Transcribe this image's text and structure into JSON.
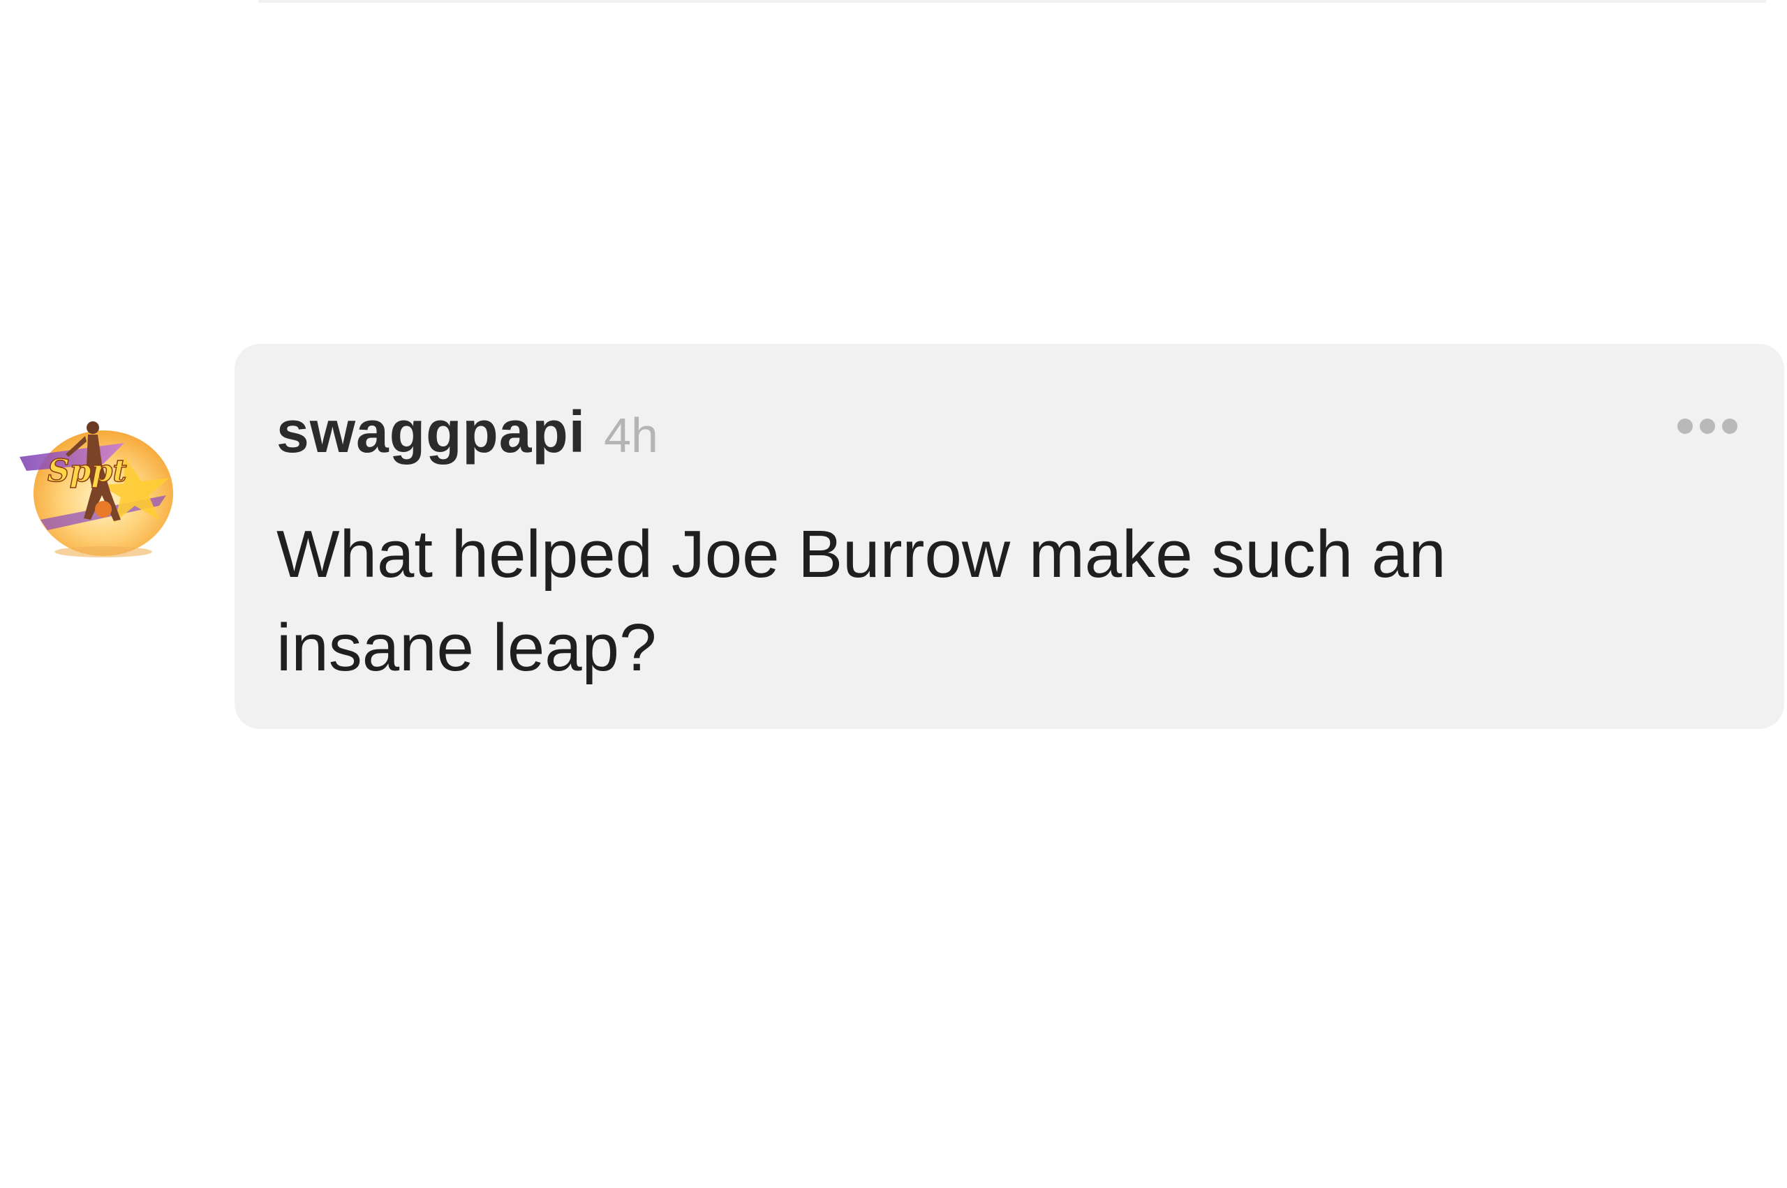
{
  "comment": {
    "username": "swaggpapi",
    "timestamp": "4h",
    "text": "What helped Joe Burrow make such an insane leap?",
    "more_icon": "ellipsis-horizontal-icon",
    "avatar_icon": "basketball-player-logo-icon"
  },
  "colors": {
    "bubble_background": "#f1f1f1",
    "username": "#2b2b2b",
    "timestamp": "#b4b4b4",
    "text": "#1f1f1f",
    "more_dots": "#b9b9b9"
  }
}
